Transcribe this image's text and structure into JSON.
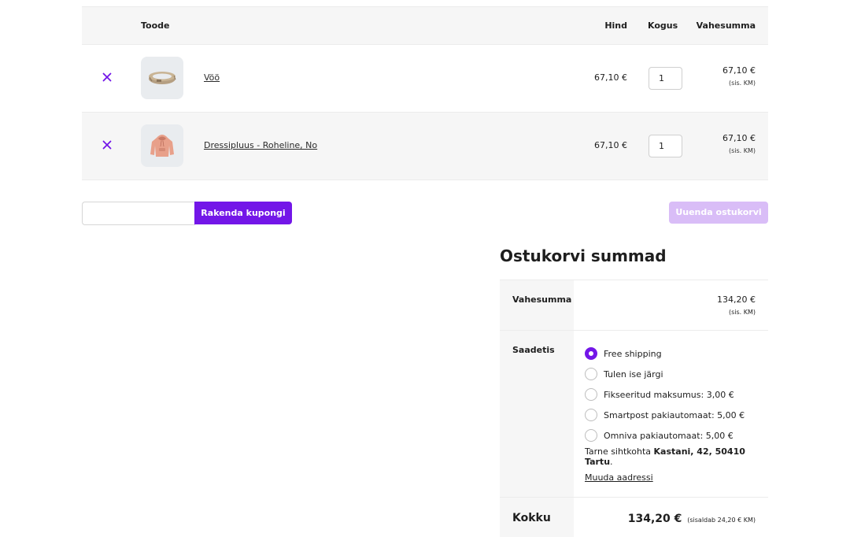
{
  "cart": {
    "headers": {
      "product": "Toode",
      "price": "Hind",
      "quantity": "Kogus",
      "subtotal": "Vahesumma"
    },
    "items": [
      {
        "name": "Vöö",
        "price": "67,10 €",
        "quantity": "1",
        "subtotal": "67,10 €",
        "tax_note": "(sis. KM)",
        "image": "belt"
      },
      {
        "name": "Dressipluus - Roheline, No",
        "price": "67,10 €",
        "quantity": "1",
        "subtotal": "67,10 €",
        "tax_note": "(sis. KM)",
        "image": "hoodie"
      }
    ],
    "remove_icon": "close-icon"
  },
  "coupon": {
    "input_value": "",
    "apply_label": "Rakenda kupongi"
  },
  "update_label": "Uuenda ostukorvi",
  "totals": {
    "title": "Ostukorvi summad",
    "subtotal_label": "Vahesumma",
    "subtotal_value": "134,20 €",
    "subtotal_tax": "(sis. KM)",
    "shipping_label": "Saadetis",
    "shipping_options": [
      {
        "label": "Free shipping",
        "selected": true
      },
      {
        "label": "Tulen ise järgi",
        "selected": false
      },
      {
        "label": "Fikseeritud maksumus: 3,00 €",
        "selected": false
      },
      {
        "label": "Smartpost pakiautomaat: 5,00 €",
        "selected": false
      },
      {
        "label": "Omniva pakiautomaat: 5,00 €",
        "selected": false
      }
    ],
    "destination_prefix": "Tarne sihtkohta",
    "destination_address": "Kastani, 42, 50410 Tartu",
    "destination_suffix": ".",
    "change_address": "Muuda aadressi",
    "total_label": "Kokku",
    "total_value": "134,20 €",
    "total_incl": "(sisaldab 24,20 € KM)"
  },
  "colors": {
    "accent": "#7316e8",
    "accent_disabled": "#d9bdf7",
    "row_alt": "#f6f6f6"
  }
}
